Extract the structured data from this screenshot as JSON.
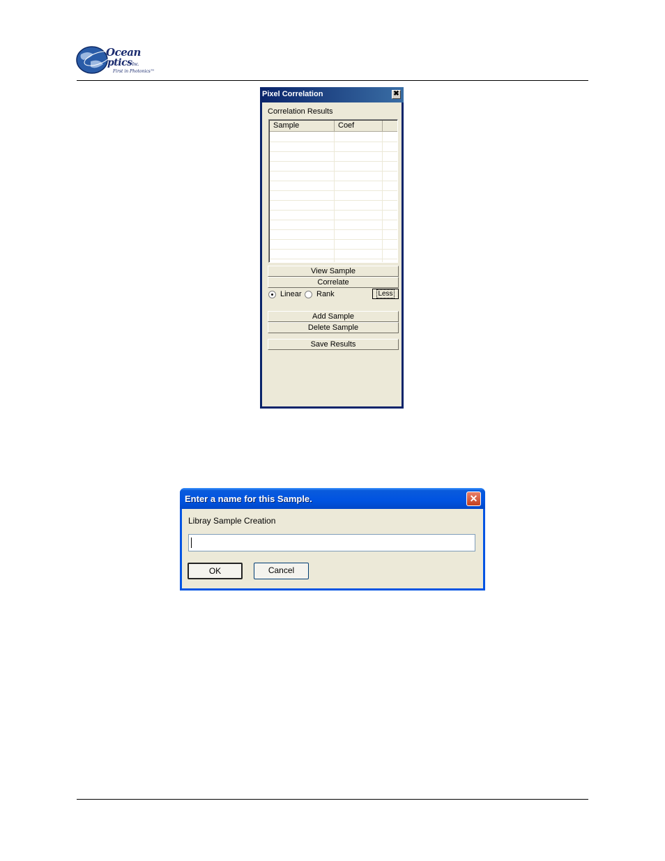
{
  "logo": {
    "line1": "Ocean",
    "line2": "ptics",
    "inc": "Inc.",
    "tagline": "First in Photonics™"
  },
  "pixel_correlation": {
    "title": "Pixel Correlation",
    "close_glyph": "✖",
    "results_label": "Correlation Results",
    "columns": [
      "Sample",
      "Coef"
    ],
    "buttons": {
      "view_sample": "View Sample",
      "correlate": "Correlate",
      "less": "Less",
      "add_sample": "Add Sample",
      "delete_sample": "Delete Sample",
      "save_results": "Save Results"
    },
    "method": {
      "options": [
        "Linear",
        "Rank"
      ],
      "selected": "Linear"
    }
  },
  "name_dialog": {
    "title": "Enter a name for this Sample.",
    "close_glyph": "✕",
    "label": "Libray Sample Creation",
    "input_value": "",
    "ok": "OK",
    "cancel": "Cancel"
  },
  "colors": {
    "xp_blue": "#0054e3",
    "classic_title": "#0a246a",
    "face": "#ece9d8"
  }
}
